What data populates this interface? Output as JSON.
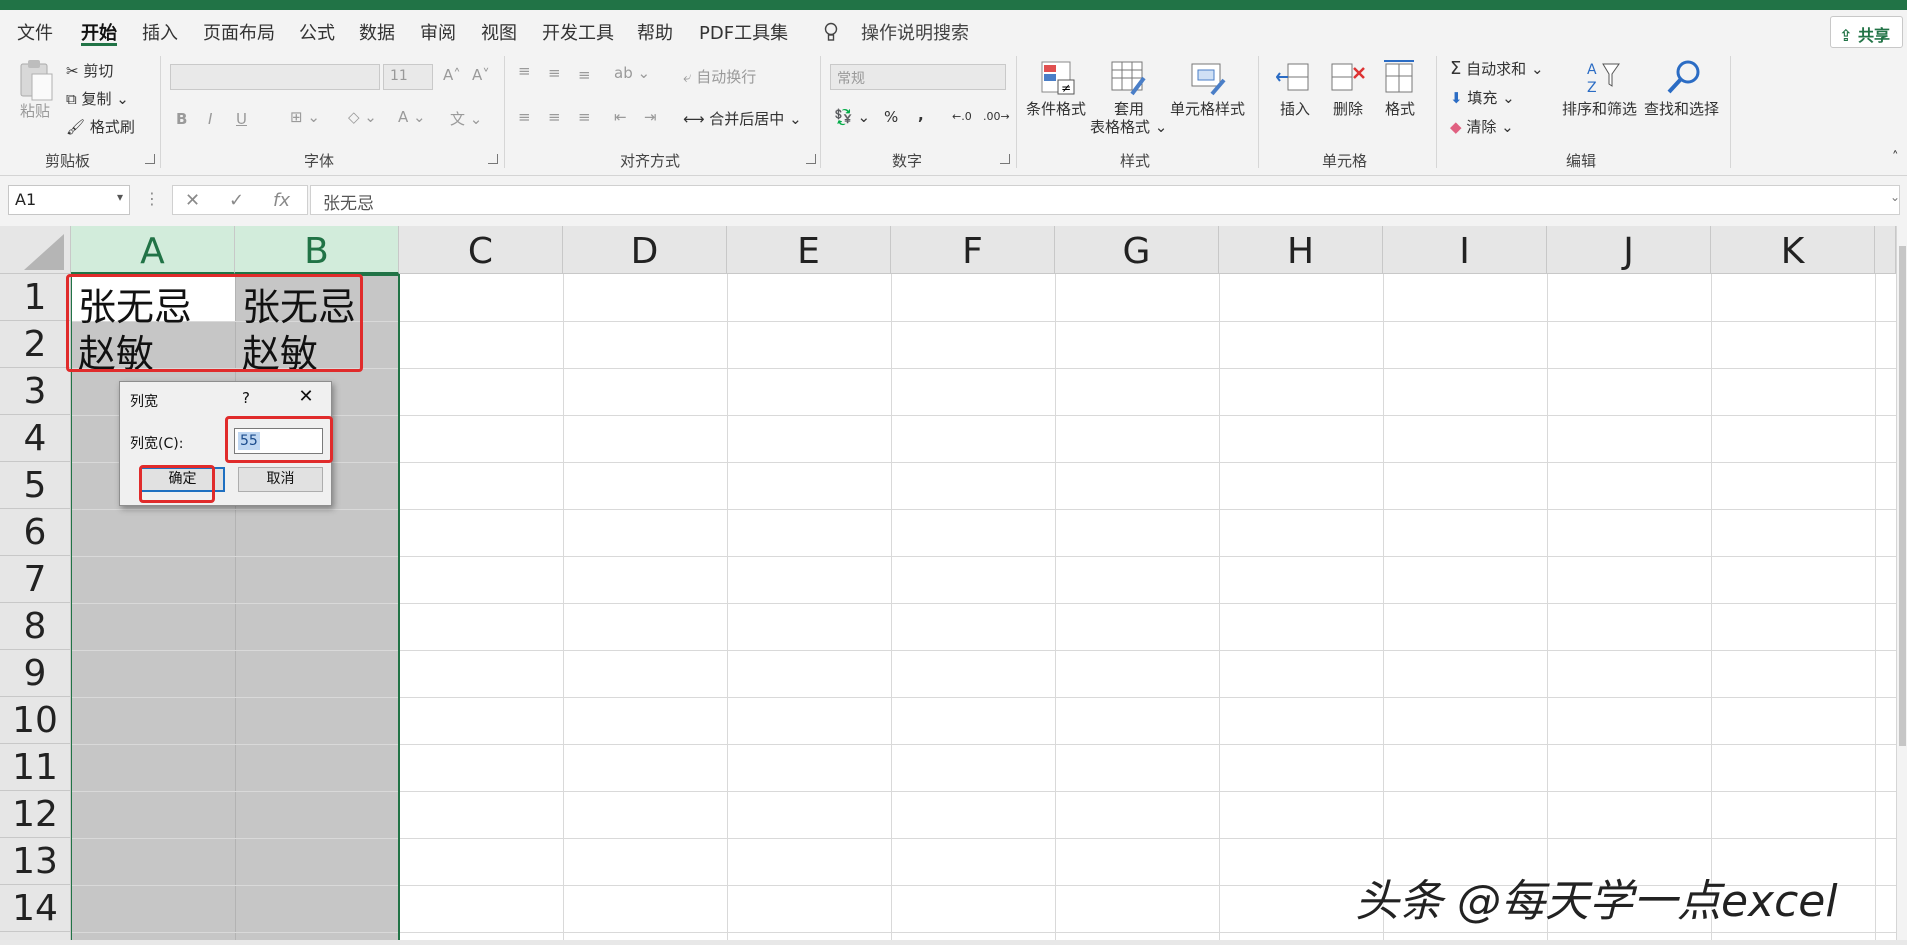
{
  "menu": {
    "tabs": [
      "文件",
      "开始",
      "插入",
      "页面布局",
      "公式",
      "数据",
      "审阅",
      "视图",
      "开发工具",
      "帮助",
      "PDF工具集"
    ],
    "active_tab": "开始",
    "search_hint": "操作说明搜索",
    "share": "共享"
  },
  "ribbon": {
    "clipboard": {
      "paste": "粘贴",
      "cut": "剪切",
      "copy": "复制",
      "format_painter": "格式刷",
      "label": "剪贴板"
    },
    "font": {
      "size": "11",
      "bold": "B",
      "italic": "I",
      "underline": "U",
      "label": "字体"
    },
    "alignment": {
      "wrap": "自动换行",
      "merge": "合并后居中",
      "label": "对齐方式"
    },
    "number": {
      "format": "常规",
      "percent": "%",
      "comma": ",",
      "label": "数字"
    },
    "styles": {
      "conditional": "条件格式",
      "table_line1": "套用",
      "table_line2": "表格格式",
      "cell_styles": "单元格样式",
      "label": "样式"
    },
    "cells": {
      "insert": "插入",
      "delete": "删除",
      "format": "格式",
      "label": "单元格"
    },
    "editing": {
      "autosum": "自动求和",
      "fill": "填充",
      "clear": "清除",
      "sort": "排序和筛选",
      "find": "查找和选择",
      "label": "编辑"
    }
  },
  "formula_bar": {
    "name_box": "A1",
    "formula": "张无忌"
  },
  "sheet": {
    "columns": [
      "A",
      "B",
      "C",
      "D",
      "E",
      "F",
      "G",
      "H",
      "I",
      "J",
      "K"
    ],
    "rows": [
      "1",
      "2",
      "3",
      "4",
      "5",
      "6",
      "7",
      "8",
      "9",
      "10",
      "11",
      "12",
      "13",
      "14"
    ],
    "cells": {
      "A1": "张无忌",
      "B1": "张无忌",
      "A2": "赵敏",
      "B2": "赵敏"
    }
  },
  "dialog": {
    "title": "列宽",
    "help": "?",
    "field_label": "列宽(C):",
    "value": "55",
    "ok": "确定",
    "cancel": "取消"
  },
  "watermark": "头条 @每天学一点excel",
  "colors": {
    "accent": "#217346",
    "annotation": "#e02b2b"
  }
}
